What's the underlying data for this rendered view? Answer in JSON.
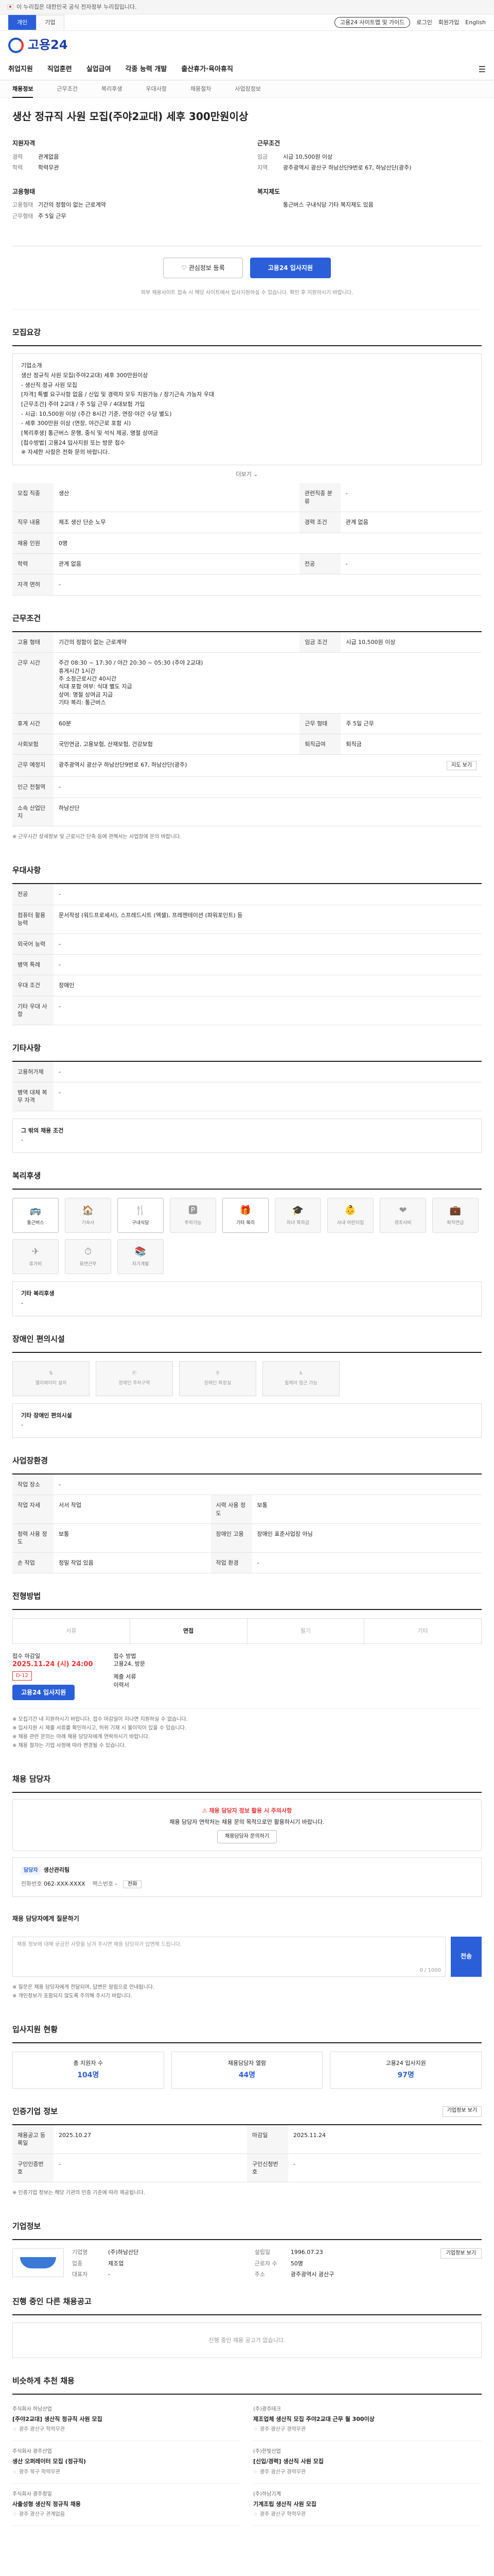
{
  "topbar": {
    "notice": "이 누리집은 대한민국 공식 전자정부 누리집입니다."
  },
  "util": {
    "tabs": [
      "개인",
      "기업"
    ],
    "right": [
      "고용24 사이트맵 및 가이드",
      "로그인",
      "회원가입",
      "English"
    ]
  },
  "logo": {
    "text": "고용24"
  },
  "gnb": [
    "취업지원",
    "직업훈련",
    "실업급여",
    "각종 능력 개발",
    "출산휴가·육아휴직"
  ],
  "subnav": [
    "채용정보",
    "근무조건",
    "복리후생",
    "우대사항",
    "채용절차",
    "사업장정보"
  ],
  "job": {
    "title": "생산 정규직 사원 모집(주야2교대) 세후 300만원이상",
    "company_group": {
      "heading": "지원자격",
      "rows": [
        {
          "k": "경력",
          "v": "관계없음"
        },
        {
          "k": "학력",
          "v": "학력무관"
        }
      ]
    },
    "work_group": {
      "heading": "근무조건",
      "rows": [
        {
          "k": "임금",
          "v": "시급 10,500원 이상"
        },
        {
          "k": "지역",
          "v": "광주광역시 광산구 하남산단9번로 67, 하남산단(광주)"
        }
      ]
    },
    "type_group": {
      "heading": "고용형태",
      "rows": [
        {
          "k": "고용형태",
          "v": "기간의 정함이 없는 근로계약"
        },
        {
          "k": "근무형태",
          "v": "주 5일 근무"
        }
      ]
    },
    "benefit_group": {
      "heading": "복지제도",
      "rows": [
        {
          "k": "",
          "v": "통근버스   구내식당   기타 복지제도 있음"
        }
      ]
    },
    "actions": {
      "scrap": "관심정보 등록",
      "apply": "고용24 입사지원"
    },
    "small_note": "외부 채용사이트 접속 시 해당 사이트에서 입사지원하실 수 있습니다. 확인 후 지원하시기 바랍니다."
  },
  "s1": {
    "title": "모집요강",
    "box_lines": [
      "기업소개",
      "생산 정규직 사원 모집(주야2교대) 세후 300만원이상",
      "- 생산직 정규 사원 모집",
      "[자격] 특별 요구사항 없음 / 신입 및 경력자 모두 지원가능 / 장기근속 가능자 우대",
      "[근무조건] 주야 2교대 / 주 5일 근무 / 4대보험 가입",
      "- 시급: 10,500원 이상 (주간 8시간 기준, 연장·야간 수당 별도)",
      "- 세후 300만원 이상 (연장, 야간근로 포함 시)",
      "[복리후생] 통근버스 운행, 중식 및 석식 제공, 명절 상여금",
      "[접수방법] 고용24 입사지원 또는 방문 접수",
      "※ 자세한 사항은 전화 문의 바랍니다."
    ],
    "more": "더보기 ⌄",
    "rows": [
      {
        "k": "모집 직종",
        "v": "생산",
        "k2": "관련직종 분류",
        "v2": "-"
      },
      {
        "k": "직무 내용",
        "v": "제조 생산 단순 노무",
        "k2": "경력 조건",
        "v2": "관계 없음"
      },
      {
        "k": "채용 인원",
        "v": "0명",
        "k2": "",
        "v2": ""
      },
      {
        "k": "학력",
        "v": "관계 없음",
        "k2": "전공",
        "v2": "-"
      },
      {
        "k": "자격 면허",
        "v": "-",
        "k2": "",
        "v2": ""
      }
    ]
  },
  "s2": {
    "title": "근무조건",
    "rows": [
      {
        "k": "고용 형태",
        "v": "기간의 정함이 없는 근로계약",
        "k2": "임금 조건",
        "v2": "시급 10,500원 이상"
      },
      {
        "k": "근무 시간",
        "v": "주간 08:30 ~ 17:30 / 야간 20:30 ~ 05:30 (주야 2교대)\n휴게시간 1시간\n주 소정근로시간 40시간\n식대 포함 여부: 식대 별도 지급\n상여: 명절 상여금 지급\n기타 복리: 통근버스",
        "k2": "",
        "v2": ""
      },
      {
        "k": "휴게 시간",
        "v": "60분",
        "k2": "근무 형태",
        "v2": "주 5일 근무"
      },
      {
        "k": "사회보험",
        "v": "국민연금, 고용보험, 산재보험, 건강보험",
        "k2": "퇴직급여",
        "v2": "퇴직금"
      },
      {
        "k": "근무 예정지",
        "v": "광주광역시 광산구 하남산단9번로 67, 하남산단(광주)",
        "k2": "",
        "v2": ""
      },
      {
        "k": "인근 전철역",
        "v": "-",
        "k2": "",
        "v2": ""
      },
      {
        "k": "소속 산업단지",
        "v": "하남산단",
        "k2": "",
        "v2": ""
      }
    ],
    "map_btn": "지도 보기",
    "note": "※ 근무시간 상세정보 및 근로시간 단축 등에 관해서는 사업장에 문의 바랍니다."
  },
  "s3": {
    "title": "우대사항",
    "rows": [
      {
        "k": "전공",
        "v": "-"
      },
      {
        "k": "컴퓨터 활용 능력",
        "v": "문서작성 (워드프로세서), 스프레드시트 (엑셀), 프레젠테이션 (파워포인트) 등"
      },
      {
        "k": "외국어 능력",
        "v": "-"
      },
      {
        "k": "병역 특례",
        "v": "-"
      },
      {
        "k": "우대 조건",
        "v": "장애인"
      },
      {
        "k": "기타 우대 사항",
        "v": "-"
      }
    ]
  },
  "s4": {
    "title": "기타사항",
    "rows": [
      {
        "k": "고용허가제",
        "v": "-"
      },
      {
        "k": "병역 대체 복무 자격",
        "v": "-"
      }
    ],
    "etc_title": "그 밖의 채용 조건",
    "etc": "-"
  },
  "s5": {
    "title": "복리후생",
    "cards": [
      {
        "g": "🚌",
        "t": "통근버스",
        "on": true
      },
      {
        "g": "🏠",
        "t": "기숙사",
        "on": false
      },
      {
        "g": "🍴",
        "t": "구내식당",
        "on": true
      },
      {
        "g": "🅿",
        "t": "주차가능",
        "on": false
      },
      {
        "g": "🎁",
        "t": "기타 복리",
        "on": true
      },
      {
        "g": "🎓",
        "t": "자녀 학자금",
        "on": false
      },
      {
        "g": "👶",
        "t": "사내 어린이집",
        "on": false
      },
      {
        "g": "❤",
        "t": "경조사비",
        "on": false
      },
      {
        "g": "💼",
        "t": "퇴직연금",
        "on": false
      },
      {
        "g": "✈",
        "t": "휴가비",
        "on": false
      },
      {
        "g": "⏱",
        "t": "유연근무",
        "on": false
      },
      {
        "g": "📚",
        "t": "자기계발",
        "on": false
      }
    ],
    "etc_title": "기타 복리후생",
    "etc": "-"
  },
  "s6": {
    "title": "장애인 편의시설",
    "cards": [
      "엘리베이터 설치",
      "장애인 주차구역",
      "장애인 화장실",
      "휠체어 접근 가능"
    ],
    "etc_title": "기타 장애인 편의시설",
    "etc": "-"
  },
  "s7": {
    "title": "사업장환경",
    "rows": [
      {
        "k": "작업 장소",
        "v": "-",
        "k2": "",
        "v2": ""
      },
      {
        "k": "작업 자세",
        "v": "서서 작업",
        "k2": "시력 사용 정도",
        "v2": "보통"
      },
      {
        "k": "청력 사용 정도",
        "v": "보통",
        "k2": "장애인 고용",
        "v2": "장애인 표준사업장 아님"
      },
      {
        "k": "손 작업",
        "v": "정밀 작업 있음",
        "k2": "작업 환경",
        "v2": "-"
      }
    ]
  },
  "s8": {
    "title": "전형방법",
    "steps": [
      {
        "t": "서류",
        "on": false
      },
      {
        "t": "면접",
        "on": true
      },
      {
        "t": "필기",
        "on": false
      },
      {
        "t": "기타",
        "on": false
      }
    ],
    "deadline_label": "접수 마감일",
    "deadline": "2025.11.24 (시) 24:00",
    "dday": "D-12",
    "apply_btn": "고용24 입사지원",
    "method_label": "접수 방법",
    "method": "고용24, 방문",
    "doc_label": "제출 서류",
    "doc": "이력서",
    "notes": [
      "※ 모집기간 내 지원하시기 바랍니다. 접수 마감일이 지나면 지원하실 수 없습니다.",
      "※ 입사지원 시 제출 서류를 확인하시고, 허위 기재 시 불이익이 있을 수 있습니다.",
      "※ 채용 관련 문의는 아래 채용 담당자에게 연락하시기 바랍니다.",
      "※ 채용 절차는 기업 사정에 따라 변경될 수 있습니다."
    ]
  },
  "s9": {
    "title": "채용 담당자",
    "alert_head": "채용 담당자 정보 활용 시 주의사항",
    "alert_body": "채용 담당자 연락처는 채용 문의 목적으로만 활용하시기 바랍니다.",
    "alert_btn": "채용담당자 문의하기",
    "contact_name": "생산관리팀",
    "contact_tag": "담당자",
    "phone_label": "전화번호",
    "phone": "062-XXX-XXXX",
    "fax_label": "팩스번호",
    "fax": "-",
    "phone_btn": "전화"
  },
  "s10": {
    "title": "채용 담당자에게 질문하기",
    "placeholder": "채용 정보에 대해 궁금한 사항을 남겨 주시면 채용 담당자가 답변해 드립니다.",
    "count": "0 / 1000",
    "send": "전송",
    "notes": [
      "※ 질문은 채용 담당자에게 전달되며, 답변은 알림으로 안내됩니다.",
      "※ 개인정보가 포함되지 않도록 주의해 주시기 바랍니다."
    ]
  },
  "s11": {
    "title": "입사지원 현황",
    "stats": [
      {
        "k": "총 지원자 수",
        "n": "104명"
      },
      {
        "k": "채용담당자 열람",
        "n": "44명"
      },
      {
        "k": "고용24 입사지원",
        "n": "97명"
      }
    ]
  },
  "s12": {
    "title": "인증기업 정보",
    "rows": [
      {
        "k": "채용공고 등록일",
        "v": "2025.10.27",
        "k2": "마감일",
        "v2": "2025.11.24"
      },
      {
        "k": "구인인증번호",
        "v": "-",
        "k2": "구인신청번호",
        "v2": "-"
      }
    ],
    "link": "기업정보 보기",
    "note": "※ 인증기업 정보는 해당 기관의 인증 기준에 따라 제공됩니다."
  },
  "s13": {
    "title": "기업정보",
    "rows": [
      {
        "k": "기업명",
        "v": "(주)하남산단",
        "k2": "설립일",
        "v2": "1996.07.23"
      },
      {
        "k": "업종",
        "v": "제조업",
        "k2": "근로자 수",
        "v2": "50명"
      },
      {
        "k": "대표자",
        "v": "-",
        "k2": "주소",
        "v2": "광주광역시 광산구"
      }
    ],
    "map_btn": "기업정보 보기"
  },
  "s14": {
    "title": "진행 중인 다른 채용공고",
    "empty": "진행 중인 채용 공고가 없습니다."
  },
  "s15": {
    "title": "비슷하게 추천 채용",
    "items": [
      {
        "co": "주식회사 하남산업",
        "t": "[주야2교대] 생산직 정규직 사원 모집",
        "meta": "광주 광산구  학력무관"
      },
      {
        "co": "(주)광주테크",
        "t": "제조업체 생산직 모집 주야2교대 근무 월 300이상",
        "meta": "광주 광산구  경력무관"
      },
      {
        "co": "주식회사 광주산업",
        "t": "생산 오퍼레이터 모집 (정규직)",
        "meta": "광주 북구  학력무관"
      },
      {
        "co": "(주)한빛산업",
        "t": "[신입/경력] 생산직 사원 모집",
        "meta": "광주 광산구  경력무관"
      },
      {
        "co": "주식회사 광주정밀",
        "t": "사출성형 생산직 정규직 채용",
        "meta": "광주 광산구  관계없음"
      },
      {
        "co": "(주)하남기계",
        "t": "기계조립 생산직 사원 모집",
        "meta": "광주 광산구  학력무관"
      }
    ]
  }
}
